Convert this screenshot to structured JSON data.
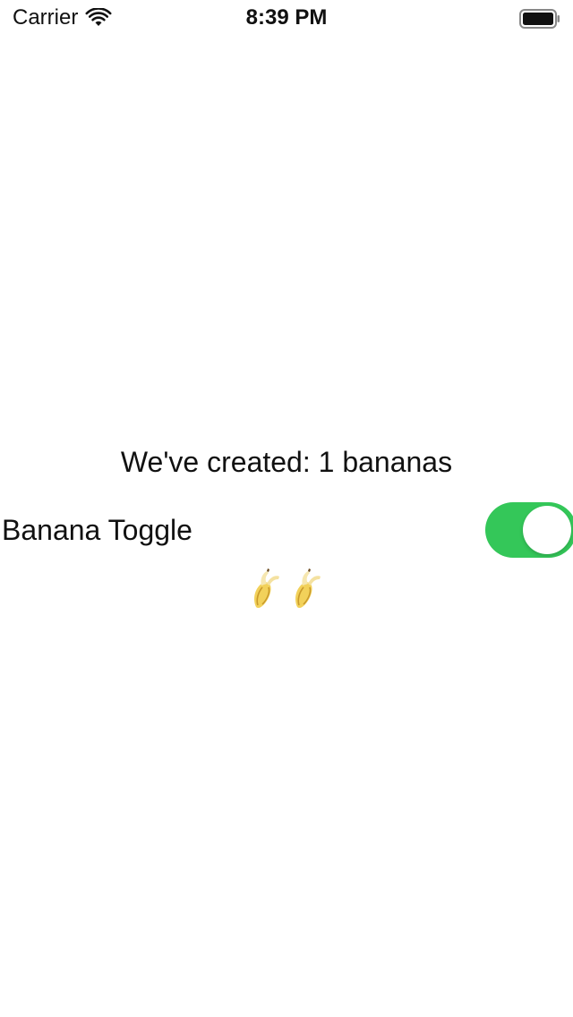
{
  "status_bar": {
    "carrier": "Carrier",
    "time": "8:39 PM",
    "wifi_icon": "wifi-icon",
    "battery_icon": "battery-icon"
  },
  "main": {
    "created_label": "We've created: 1 bananas",
    "toggle": {
      "label": "Banana Toggle",
      "is_on": true,
      "on_color": "#34c759"
    },
    "bananas": [
      {
        "icon": "banana-icon"
      },
      {
        "icon": "banana-icon"
      }
    ]
  }
}
